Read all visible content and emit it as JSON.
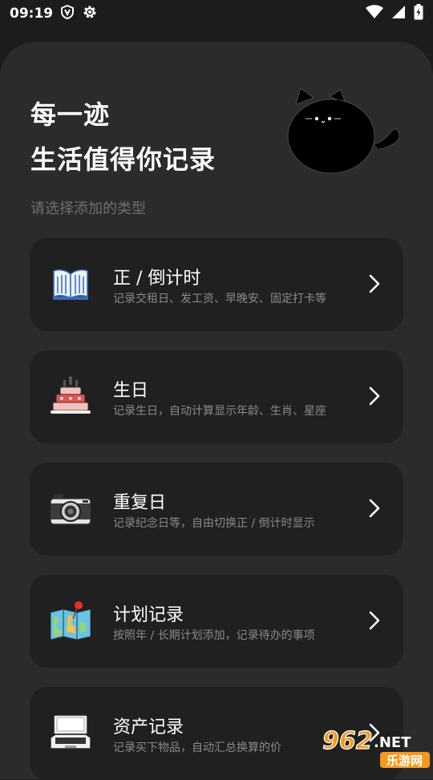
{
  "status_bar": {
    "time": "09:19"
  },
  "header": {
    "title_line1": "每一迹",
    "title_line2": "生活值得你记录",
    "subtitle": "请选择添加的类型"
  },
  "types": [
    {
      "title": "正 / 倒计时",
      "desc": "记录交租日、发工资、早晚安、固定打卡等",
      "icon": "book-icon"
    },
    {
      "title": "生日",
      "desc": "记录生日，自动计算显示年龄、生肖、星座",
      "icon": "cake-icon"
    },
    {
      "title": "重复日",
      "desc": "记录纪念日等，自由切换正 / 倒计时显示",
      "icon": "camera-icon"
    },
    {
      "title": "计划记录",
      "desc": "按照年 / 长期计划添加，记录待办的事项",
      "icon": "map-icon"
    },
    {
      "title": "资产记录",
      "desc": "记录买下物品，自动汇总换算的价",
      "icon": "laptop-icon"
    }
  ],
  "watermark": {
    "number": "962",
    "suffix": ".NET",
    "sub": "乐游网"
  },
  "colors": {
    "background": "#1c1c1c",
    "sheet": "#2b2b2b",
    "card": "#202020",
    "muted_text": "#8a8a8a",
    "watermark_orange": "#f39a1e"
  }
}
